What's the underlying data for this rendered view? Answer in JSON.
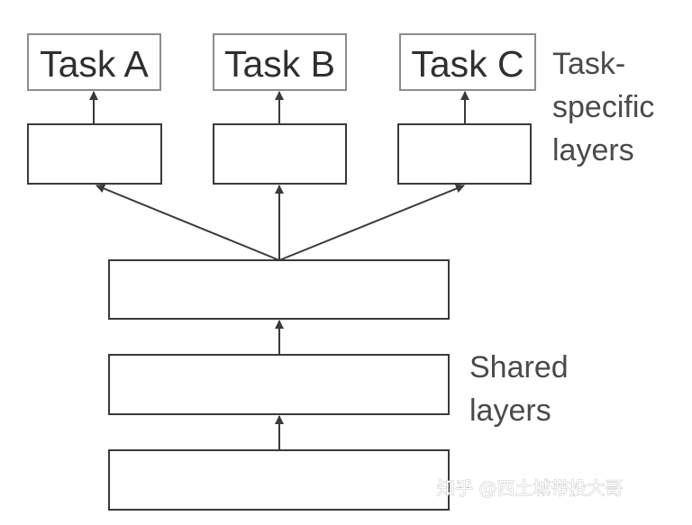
{
  "tasks": [
    {
      "label": "Task A"
    },
    {
      "label": "Task B"
    },
    {
      "label": "Task C"
    }
  ],
  "labels": {
    "task_specific": [
      "Task-",
      "specific",
      "layers"
    ],
    "shared": [
      "Shared",
      "layers"
    ]
  },
  "watermark": "知乎 @西土城带投大哥",
  "colors": {
    "task_box_stroke": "#8c8c8c",
    "layer_box_stroke": "#3a3a3a",
    "text": "#2f2f2f",
    "label_text": "#4a4a4a"
  }
}
